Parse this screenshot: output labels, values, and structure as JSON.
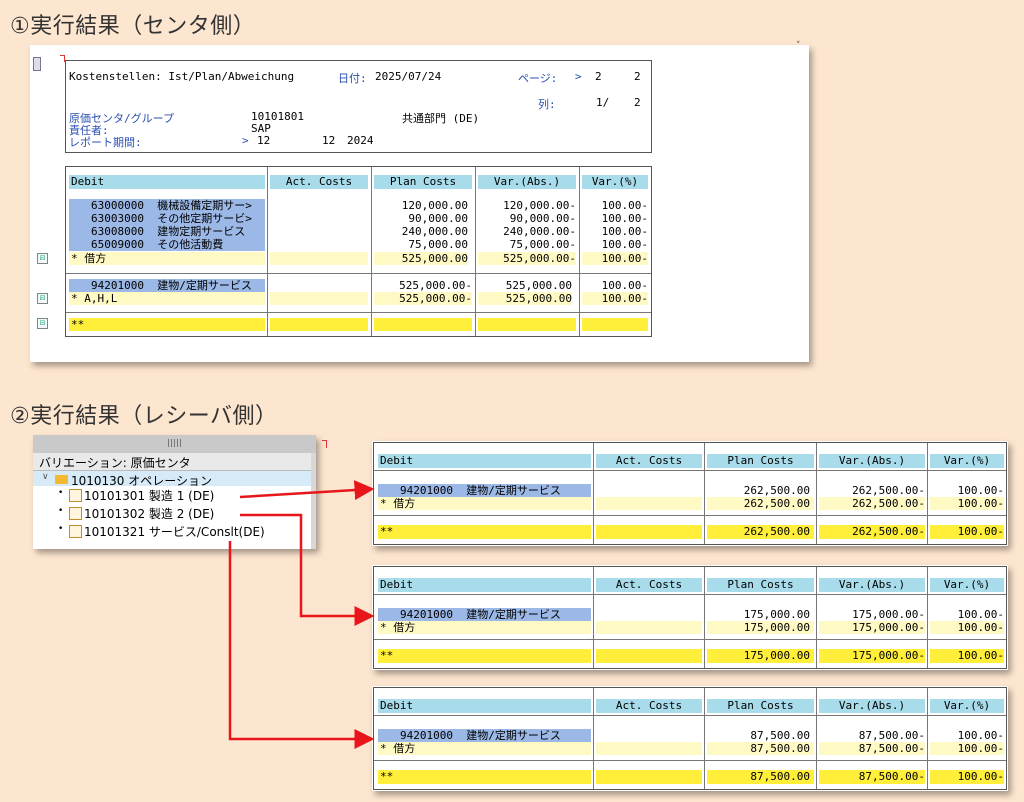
{
  "section1_title": "①実行結果（センタ側）",
  "section2_title": "②実行結果（レシーバ側）",
  "report": {
    "title": "Kostenstellen: Ist/Plan/Abweichung",
    "date_label": "日付:",
    "date": "2025/07/24",
    "page_label": "ページ:",
    "page_arrow": ">",
    "page_num": "2",
    "page_total": "2",
    "col_label": "列:",
    "col_num": "1/",
    "col_total": "2",
    "cc_label": "原価センタ/グループ",
    "cc_value": "10101801",
    "cc_name": "共通部門 (DE)",
    "resp_label": "責任者:",
    "resp_value": "SAP",
    "period_label": "レポート期間:",
    "period_arrow": ">",
    "period_from": "12",
    "period_to": "12",
    "period_year": "2024"
  },
  "columns": {
    "debit": "Debit",
    "act": "Act. Costs",
    "plan": "Plan Costs",
    "var_abs": "Var.(Abs.)",
    "var_pct": "Var.(%)"
  },
  "main_table": {
    "rows": [
      {
        "acct": "63000000",
        "name": "機械設備定期サー>",
        "plan": "120,000.00",
        "var": "120,000.00-",
        "pct": "100.00-"
      },
      {
        "acct": "63003000",
        "name": "その他定期サービ>",
        "plan": "90,000.00",
        "var": "90,000.00-",
        "pct": "100.00-"
      },
      {
        "acct": "63008000",
        "name": "建物定期サービス",
        "plan": "240,000.00",
        "var": "240,000.00-",
        "pct": "100.00-"
      },
      {
        "acct": "65009000",
        "name": "その他活動費",
        "plan": "75,000.00",
        "var": "75,000.00-",
        "pct": "100.00-"
      }
    ],
    "sub1_label": "*  借方",
    "sub1_plan": "525,000.00",
    "sub1_var": "525,000.00-",
    "sub1_pct": "100.00-",
    "credit_acct": "94201000",
    "credit_name": "建物/定期サービス",
    "credit_plan": "525,000.00-",
    "credit_var": "525,000.00",
    "credit_pct": "100.00-",
    "sub2_label": "*  A,H,L",
    "sub2_plan": "525,000.00-",
    "sub2_var": "525,000.00",
    "sub2_pct": "100.00-",
    "total_label": "**"
  },
  "tree": {
    "header": "バリエーション: 原価センタ",
    "root": "1010130 オペレーション",
    "items": [
      "10101301 製造 1 (DE)",
      "10101302 製造 2 (DE)",
      "10101321 サービス/Conslt(DE)"
    ]
  },
  "receivers": [
    {
      "acct": "94201000",
      "name": "建物/定期サービス",
      "plan": "262,500.00",
      "var": "262,500.00-",
      "pct": "100.00-",
      "sub_label": "*  借方",
      "sub_plan": "262,500.00",
      "sub_var": "262,500.00-",
      "sub_pct": "100.00-",
      "tot_label": "**",
      "tot_plan": "262,500.00",
      "tot_var": "262,500.00-",
      "tot_pct": "100.00-"
    },
    {
      "acct": "94201000",
      "name": "建物/定期サービス",
      "plan": "175,000.00",
      "var": "175,000.00-",
      "pct": "100.00-",
      "sub_label": "*  借方",
      "sub_plan": "175,000.00",
      "sub_var": "175,000.00-",
      "sub_pct": "100.00-",
      "tot_label": "**",
      "tot_plan": "175,000.00",
      "tot_var": "175,000.00-",
      "tot_pct": "100.00-"
    },
    {
      "acct": "94201000",
      "name": "建物/定期サービス",
      "plan": "87,500.00",
      "var": "87,500.00-",
      "pct": "100.00-",
      "sub_label": "*  借方",
      "sub_plan": "87,500.00",
      "sub_var": "87,500.00-",
      "sub_pct": "100.00-",
      "tot_label": "**",
      "tot_plan": "87,500.00",
      "tot_var": "87,500.00-",
      "tot_pct": "100.00-"
    }
  ],
  "colors": {
    "background": "#fde6cf",
    "header_cell": "#a9dcea",
    "account_cell": "#9cb8e6",
    "subtotal": "#fff9c4",
    "total": "#ffef3a",
    "arrow": "#e8161b"
  }
}
